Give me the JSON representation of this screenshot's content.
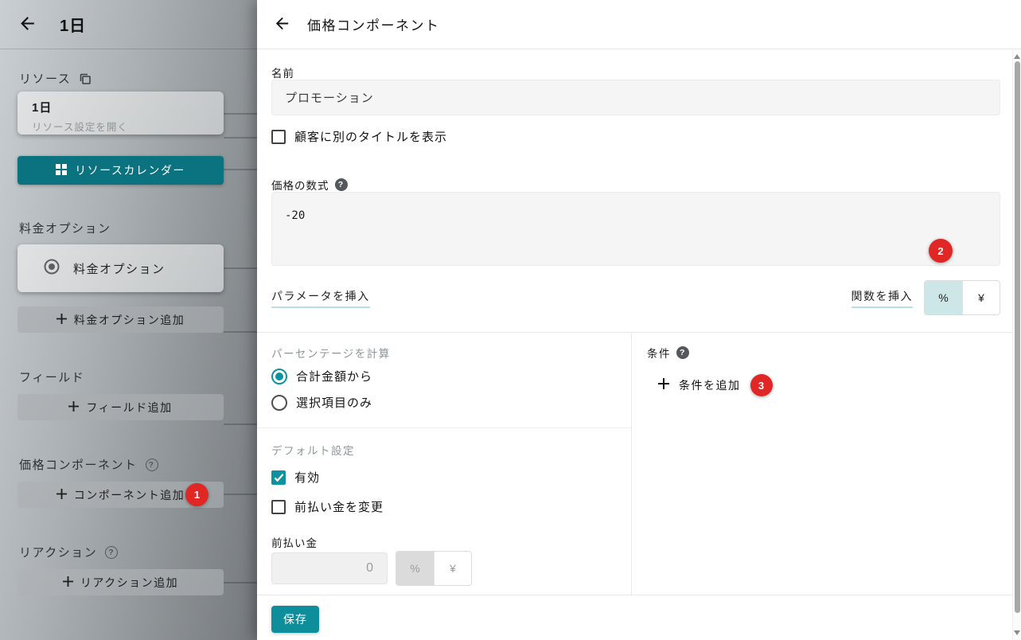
{
  "colors": {
    "accent_teal": "#0e8e9a",
    "sidebar_teal": "#0b737f",
    "badge_red": "#e12626",
    "toggle_selected_bg": "#cde7e9"
  },
  "sidebar": {
    "title": "1日",
    "resource": {
      "section_label": "リソース",
      "card_title": "1日",
      "card_subtitle": "リソース設定を開く",
      "calendar_button": "リソースカレンダー"
    },
    "price_options": {
      "section_label": "料金オプション",
      "card_label": "料金オプション",
      "add_button": "料金オプション追加"
    },
    "fields": {
      "section_label": "フィールド",
      "add_button": "フィールド追加"
    },
    "components": {
      "section_label": "価格コンポーネント",
      "add_button": "コンポーネント追加",
      "badge": "1"
    },
    "reactions": {
      "section_label": "リアクション",
      "add_button": "リアクション追加"
    }
  },
  "drawer": {
    "title": "価格コンポーネント",
    "name": {
      "label": "名前",
      "value": "プロモーション"
    },
    "alt_title_checkbox": {
      "label": "顧客に別のタイトルを表示",
      "checked": false
    },
    "formula": {
      "label": "価格の数式",
      "value": "-20",
      "badge": "2"
    },
    "insert_parameter": "パラメータを挿入",
    "insert_function": "関数を挿入",
    "unit_toggle": {
      "percent": "%",
      "yen": "¥",
      "selected": "percent"
    },
    "percentage_calc": {
      "label": "パーセンテージを計算",
      "options": [
        {
          "label": "合計金額から",
          "selected": true
        },
        {
          "label": "選択項目のみ",
          "selected": false
        }
      ]
    },
    "defaults": {
      "label": "デフォルト設定",
      "enabled": {
        "label": "有効",
        "checked": true
      },
      "change_prepayment": {
        "label": "前払い金を変更",
        "checked": false
      }
    },
    "prepayment": {
      "label": "前払い金",
      "value": "0",
      "disabled": true,
      "unit_toggle": {
        "percent": "%",
        "yen": "¥",
        "selected": "percent"
      }
    },
    "conditions": {
      "label": "条件",
      "add_label": "条件を追加",
      "badge": "3"
    },
    "save_button": "保存"
  }
}
